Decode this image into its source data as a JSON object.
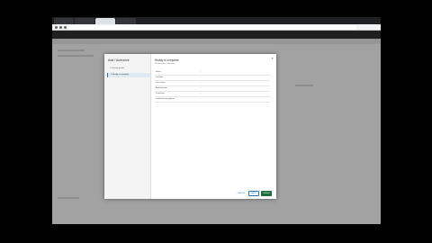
{
  "browser": {
    "tabs": [
      {
        "label": ""
      },
      {
        "label": ""
      },
      {
        "label": ""
      },
      {
        "label": ""
      }
    ],
    "url": ""
  },
  "dialog": {
    "title": "Add / Authorize",
    "close_icon": "close-icon",
    "steps": [
      {
        "label": "1 Provide details"
      },
      {
        "label": "2 Ready to complete"
      }
    ],
    "current_step": {
      "title": "Ready to complete",
      "subtitle": "Review your selections"
    },
    "rows": [
      {
        "key": "Name",
        "value": "..."
      },
      {
        "key": "Location",
        "value": "..."
      },
      {
        "key": "User name",
        "value": "..."
      },
      {
        "key": "Authorization",
        "value": "..."
      },
      {
        "key": "Certificate",
        "value": "..."
      },
      {
        "key": "Certificate thumbprint",
        "value": "..."
      }
    ],
    "buttons": {
      "cancel": "CANCEL",
      "back": "BACK",
      "finish": "FINISH"
    }
  }
}
